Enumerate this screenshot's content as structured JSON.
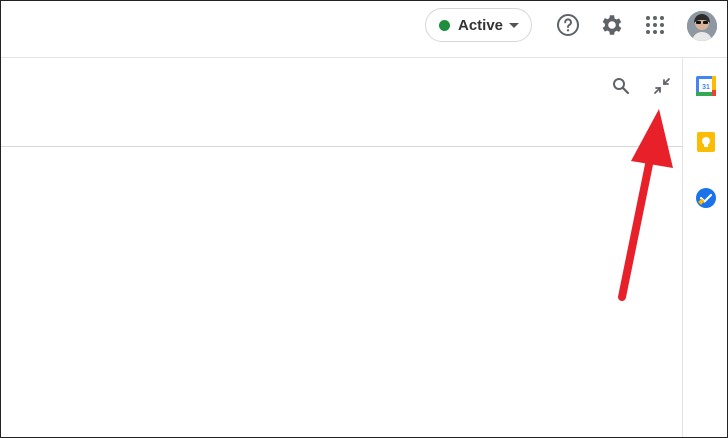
{
  "header": {
    "status": {
      "label": "Active",
      "color": "#1e8e3e"
    },
    "icons": [
      "help-icon",
      "settings-icon",
      "apps-grid-icon",
      "avatar"
    ]
  },
  "panel": {
    "icons": [
      "search-icon",
      "collapse-icon"
    ]
  },
  "side_panel": {
    "apps": [
      {
        "name": "calendar",
        "badge": "31"
      },
      {
        "name": "keep"
      },
      {
        "name": "tasks"
      }
    ]
  },
  "annotation": {
    "arrow_color": "#e8202a"
  }
}
